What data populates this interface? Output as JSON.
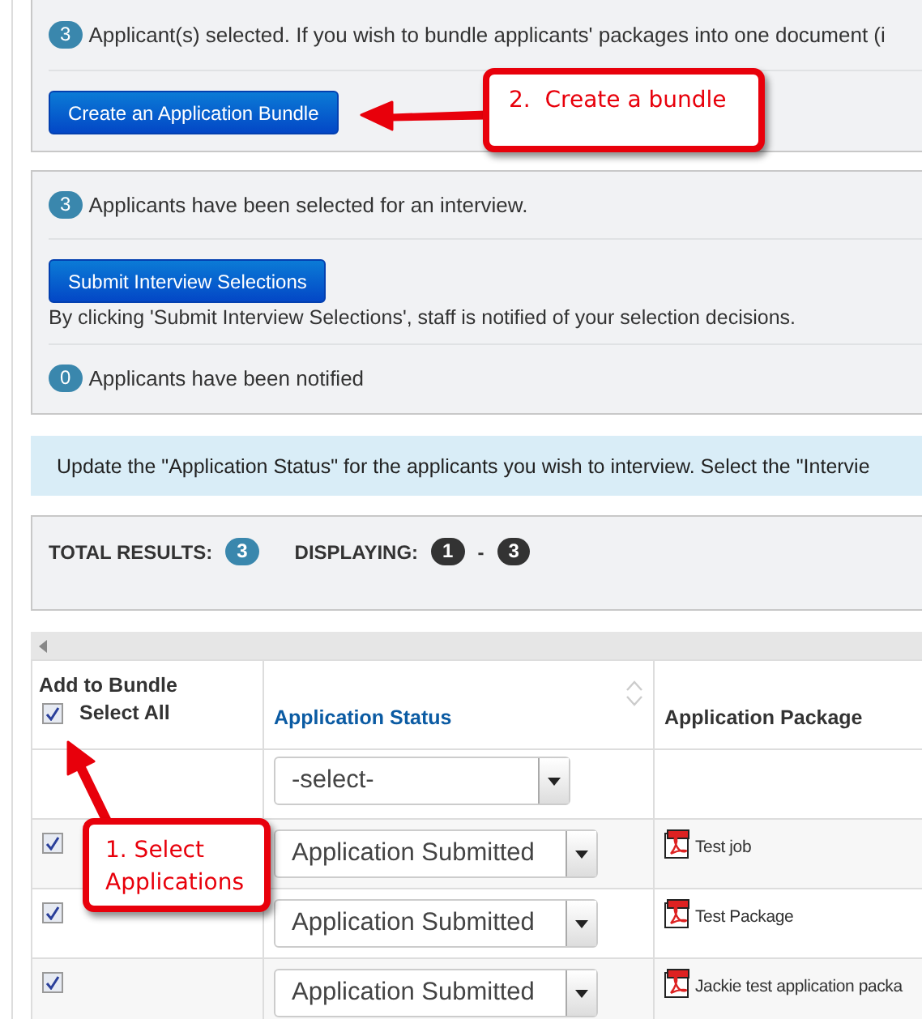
{
  "bundle_panel": {
    "count": "3",
    "message": "Applicant(s) selected. If you wish to bundle applicants' packages into one document (i",
    "button": "Create an Application Bundle"
  },
  "interview_panel": {
    "selected_count": "3",
    "selected_message": "Applicants have been selected for an interview.",
    "button": "Submit Interview Selections",
    "note": "By clicking 'Submit Interview Selections', staff is notified of your selection decisions.",
    "notified_count": "0",
    "notified_message": "Applicants have been notified"
  },
  "info_bar": "Update the \"Application Status\" for the applicants you wish to interview. Select the \"Intervie",
  "results": {
    "total_label": "TOTAL RESULTS:",
    "total": "3",
    "displaying_label": "DISPLAYING:",
    "from": "1",
    "separator": "-",
    "to": "3"
  },
  "table": {
    "columns": [
      {
        "label": "Add to Bundle",
        "select_all": {
          "label": "Select All",
          "checked": true
        }
      },
      {
        "label": "Application Status",
        "sortable": true
      },
      {
        "label": "Application Package"
      }
    ],
    "filter": {
      "status": "-select-"
    },
    "rows": [
      {
        "checked": true,
        "status": "Application Submitted",
        "package": "Test job"
      },
      {
        "checked": true,
        "status": "Application Submitted",
        "package": "Test Package"
      },
      {
        "checked": true,
        "status": "Application Submitted",
        "package": "Jackie test application packa"
      }
    ]
  },
  "annotations": [
    {
      "text": "2.  Create a bundle",
      "kind": "bundle"
    },
    {
      "text": "1. Select Applications",
      "kind": "select"
    }
  ]
}
